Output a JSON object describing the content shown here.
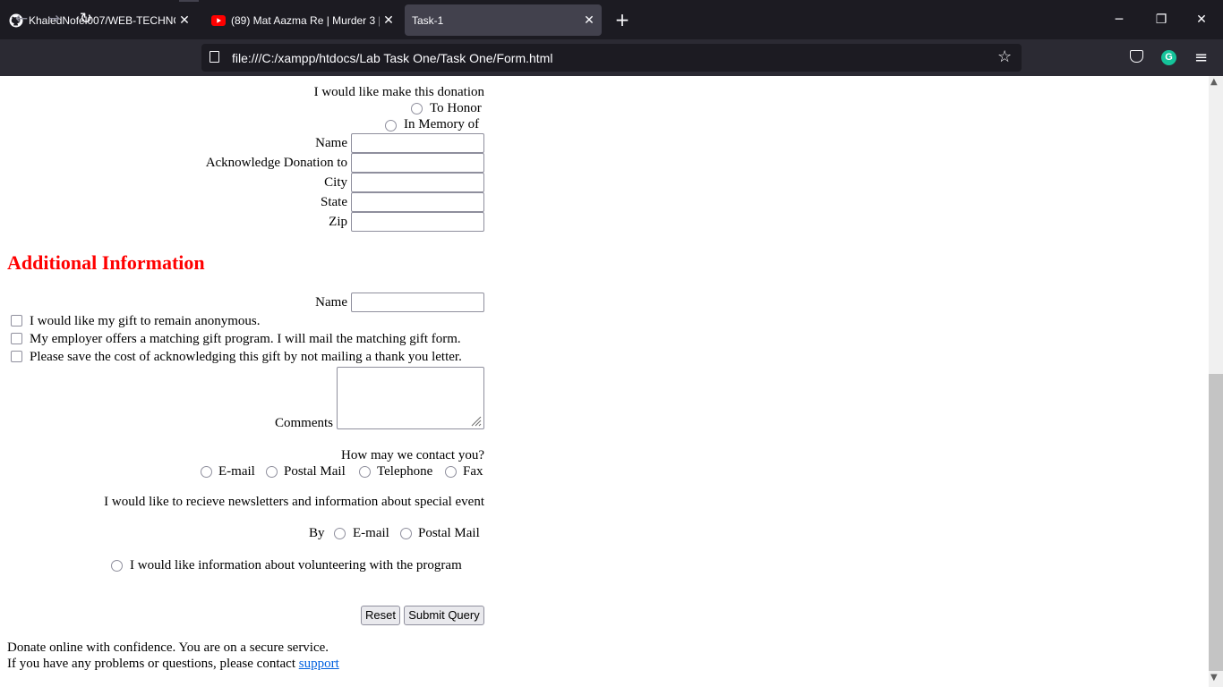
{
  "browser": {
    "tabs": [
      {
        "title": "KhaledNofel007/WEB-TECHNOLOGIES",
        "favicon": "github-icon"
      },
      {
        "title": "(89) Mat Aazma Re | Murder 3 | Emraan Hashmi",
        "favicon": "youtube-icon"
      },
      {
        "title": "Task-1",
        "favicon": ""
      }
    ],
    "url": "file:///C:/xampp/htdocs/Lab Task One/Task One/Form.html"
  },
  "donation": {
    "intro": "I would like make this donation",
    "options": [
      "To Honor",
      "In Memory of"
    ],
    "fields": [
      "Name",
      "Acknowledge Donation to",
      "City",
      "State",
      "Zip"
    ]
  },
  "additional": {
    "heading": "Additional Information",
    "name_label": "Name",
    "checkboxes": [
      "I would like my gift to remain anonymous.",
      "My employer offers a matching gift program. I will mail the matching gift form.",
      "Please save the cost of acknowledging this gift by not mailing a thank you letter."
    ],
    "comments_label": "Comments"
  },
  "contact": {
    "question": "How may we contact you?",
    "options": [
      "E-mail",
      "Postal Mail",
      "Telephone",
      "Fax"
    ]
  },
  "newsletter": {
    "text": "I would like to recieve newsletters and information about special event",
    "by_label": "By",
    "options": [
      "E-mail",
      "Postal Mail"
    ]
  },
  "volunteer": {
    "text": "I would like information about volunteering with the program"
  },
  "buttons": {
    "reset": "Reset",
    "submit": "Submit Query"
  },
  "footer": {
    "line1": "Donate online with confidence. You are on a secure service.",
    "line2": "If you have any problems or questions, please contact ",
    "link": "support"
  }
}
